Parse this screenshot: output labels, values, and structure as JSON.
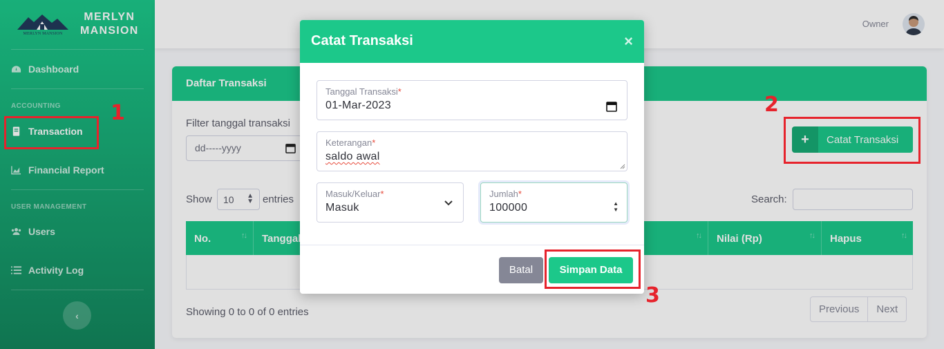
{
  "brand": {
    "name_line1": "MERLYN",
    "name_line2": "MANSION",
    "logo_text": "MERLYN MANSION"
  },
  "sidebar": {
    "items": [
      {
        "label": "Dashboard",
        "icon": "tachometer-icon"
      },
      {
        "label": "Transaction",
        "icon": "book-icon",
        "active": true
      },
      {
        "label": "Financial Report",
        "icon": "chart-area-icon"
      },
      {
        "label": "Users",
        "icon": "users-icon"
      },
      {
        "label": "Activity Log",
        "icon": "list-icon"
      }
    ],
    "sections": {
      "accounting": "ACCOUNTING",
      "user_management": "USER MANAGEMENT"
    },
    "toggle_icon": "‹"
  },
  "topbar": {
    "user_name": "Owner"
  },
  "card": {
    "title": "Daftar Transaksi",
    "filter_label": "Filter tanggal transaksi",
    "filter_placeholder": "dd-----yyyy",
    "add_button": "Catat Transaksi",
    "show_label": "Show",
    "show_value": "10",
    "entries_label": "entries",
    "search_label": "Search:",
    "columns": [
      "No.",
      "Tanggal",
      "Nilai (Rp)",
      "Hapus"
    ],
    "showing": "Showing 0 to 0 of 0 entries",
    "pager": {
      "previous": "Previous",
      "next": "Next"
    }
  },
  "modal": {
    "title": "Catat Transaksi",
    "close": "×",
    "fields": {
      "date": {
        "label": "Tanggal Transaksi",
        "value": "01-Mar-2023"
      },
      "desc": {
        "label": "Keterangan",
        "value": "saldo awal"
      },
      "type": {
        "label": "Masuk/Keluar",
        "value": "Masuk"
      },
      "amount": {
        "label": "Jumlah",
        "value": "100000"
      }
    },
    "required_mark": "*",
    "cancel": "Batal",
    "save": "Simpan Data"
  },
  "annotations": {
    "one": "1",
    "two": "2",
    "three": "3"
  },
  "colors": {
    "primary": "#1cc88a",
    "highlight": "#e6232c",
    "secondary": "#858796"
  }
}
